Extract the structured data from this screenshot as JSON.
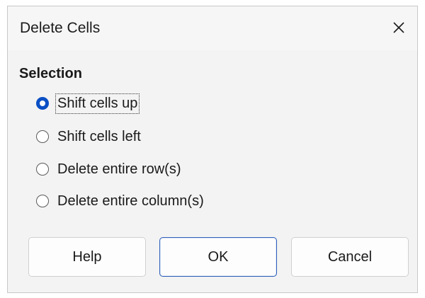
{
  "dialog": {
    "title": "Delete Cells",
    "close_icon": "close-icon"
  },
  "selection": {
    "label": "Selection",
    "options": [
      {
        "label": "Shift cells up",
        "checked": true
      },
      {
        "label": "Shift cells left",
        "checked": false
      },
      {
        "label": "Delete entire row(s)",
        "checked": false
      },
      {
        "label": "Delete entire column(s)",
        "checked": false
      }
    ]
  },
  "buttons": {
    "help": "Help",
    "ok": "OK",
    "cancel": "Cancel"
  },
  "colors": {
    "accent": "#0a4fc4",
    "dialog_bg": "#f3f3f3"
  }
}
